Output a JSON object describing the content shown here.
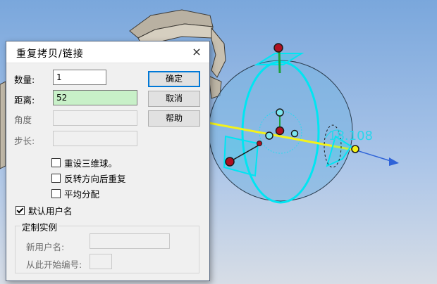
{
  "dialog": {
    "title": "重复拷贝/链接",
    "close_icon": "×",
    "fields": {
      "count": {
        "label": "数量:",
        "value": "1"
      },
      "distance": {
        "label": "距离:",
        "value": "52"
      },
      "angle": {
        "label": "角度",
        "value": ""
      },
      "step": {
        "label": "步长:",
        "value": ""
      }
    },
    "buttons": {
      "ok": "确定",
      "cancel": "取消",
      "help": "帮助"
    },
    "checkboxes": {
      "reset_3d_ball": {
        "label": "重设三维球。",
        "checked": false
      },
      "reverse_repeat": {
        "label": "反转方向后重复",
        "checked": false
      },
      "even_distribute": {
        "label": "平均分配",
        "checked": false
      },
      "default_user_name": {
        "label": "默认用户名",
        "checked": true
      }
    },
    "custom_instance": {
      "title": "定制实例",
      "new_user_name_label": "新用户名:",
      "new_user_name_value": "",
      "start_number_label": "从此开始编号:",
      "start_number_value": ""
    }
  },
  "viewport": {
    "dimension_label": "18.108",
    "colors": {
      "handle_cyan": "#00e5f2",
      "axis_yellow": "#f4f21a",
      "node_red": "#b01020",
      "dimension_cyan": "#29d6ec",
      "axis_blue": "#2f63d8"
    }
  }
}
